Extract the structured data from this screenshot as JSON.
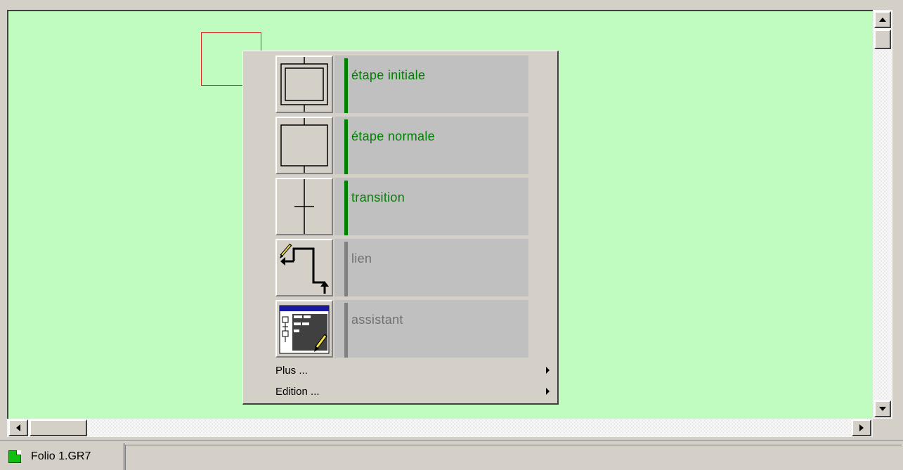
{
  "menu": {
    "items": [
      {
        "label": "étape initiale",
        "color": "#008000",
        "bar": "#008000",
        "icon": "initial-step-icon"
      },
      {
        "label": "étape normale",
        "color": "#008000",
        "bar": "#008000",
        "icon": "normal-step-icon"
      },
      {
        "label": "transition",
        "color": "#008000",
        "bar": "#008000",
        "icon": "transition-icon"
      },
      {
        "label": "lien",
        "color": "#707070",
        "bar": "#808080",
        "icon": "link-icon"
      },
      {
        "label": "assistant",
        "color": "#707070",
        "bar": "#808080",
        "icon": "assistant-icon"
      }
    ],
    "submenus": [
      {
        "label": "Plus ..."
      },
      {
        "label": "Edition ..."
      }
    ]
  },
  "statusbar": {
    "tab_label": "Folio 1.GR7"
  },
  "colors": {
    "canvas": "#c0fcc0",
    "selection": "#e02020"
  }
}
